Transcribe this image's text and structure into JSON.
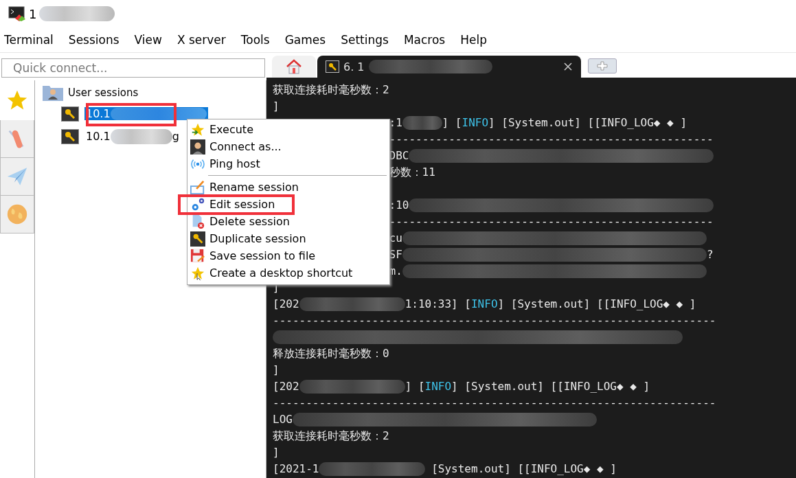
{
  "window": {
    "title": "1"
  },
  "menu_bar": [
    "Terminal",
    "Sessions",
    "View",
    "X server",
    "Tools",
    "Games",
    "Settings",
    "Macros",
    "Help"
  ],
  "quick_connect": {
    "placeholder": "Quick connect..."
  },
  "side_tabs": [
    {
      "selected": true
    },
    {
      "selected": false
    },
    {
      "selected": false
    },
    {
      "selected": false
    }
  ],
  "tree": {
    "label": "User sessions",
    "children": [
      {
        "label": "10.1",
        "selected": true,
        "annotated": true
      },
      {
        "label": "10.1",
        "suffix": "g",
        "selected": false,
        "annotated": false
      }
    ]
  },
  "tabs": [
    {
      "kind": "home",
      "selected": false
    },
    {
      "kind": "session",
      "label": "6. 1",
      "selected": true
    },
    {
      "kind": "new",
      "selected": false
    }
  ],
  "context_menu": [
    {
      "kind": "item",
      "label": "Execute",
      "annotated": false
    },
    {
      "kind": "item",
      "label": "Connect as...",
      "annotated": false
    },
    {
      "kind": "item",
      "label": "Ping host",
      "annotated": false
    },
    {
      "kind": "separator"
    },
    {
      "kind": "item",
      "label": "Rename session",
      "annotated": false
    },
    {
      "kind": "item",
      "label": "Edit session",
      "annotated": true
    },
    {
      "kind": "item",
      "label": "Delete session",
      "annotated": false
    },
    {
      "kind": "item",
      "label": "Duplicate session",
      "annotated": false
    },
    {
      "kind": "item",
      "label": "Save session to file",
      "annotated": false
    },
    {
      "kind": "item",
      "label": "Create a desktop shortcut",
      "annotated": false
    }
  ],
  "terminal_lines": [
    {
      "segments": [
        {
          "kind": "text",
          "text": "获取连接耗时毫秒数：2"
        }
      ]
    },
    {
      "segments": [
        {
          "kind": "text",
          "text": "]"
        }
      ]
    },
    {
      "segments": [
        {
          "kind": "hidden"
        },
        {
          "kind": "text",
          "text": ":1"
        },
        {
          "kind": "blur"
        },
        {
          "kind": "text",
          "text": "] ["
        },
        {
          "kind": "info",
          "text": "INFO"
        },
        {
          "kind": "text",
          "text": "] [System.out] [[INFO_LOG◆ ◆ ]"
        }
      ]
    },
    {
      "segments": [
        {
          "kind": "hidden"
        },
        {
          "kind": "text",
          "text": "-------------------------------------------------"
        }
      ]
    },
    {
      "segments": [
        {
          "kind": "hidden"
        },
        {
          "kind": "text",
          "text": "DBC"
        },
        {
          "kind": "blur"
        }
      ]
    },
    {
      "segments": [
        {
          "kind": "hidden"
        },
        {
          "kind": "text",
          "text": "秒数：11"
        }
      ]
    },
    {
      "blank_before": true,
      "segments": [
        {
          "kind": "hidden"
        },
        {
          "kind": "text",
          "text": ":10"
        },
        {
          "kind": "blur"
        }
      ]
    },
    {
      "segments": [
        {
          "kind": "hidden"
        },
        {
          "kind": "text",
          "text": "-------------------------------------------------"
        }
      ]
    },
    {
      "segments": [
        {
          "kind": "hidden"
        },
        {
          "kind": "text",
          "text": "cu"
        },
        {
          "kind": "blur"
        }
      ]
    },
    {
      "segments": [
        {
          "kind": "hidden"
        },
        {
          "kind": "text",
          "text": "SF"
        },
        {
          "kind": "blur"
        },
        {
          "kind": "text",
          "text": "?"
        }
      ]
    },
    {
      "segments": [
        {
          "kind": "hidden"
        },
        {
          "kind": "text",
          "text": "m."
        },
        {
          "kind": "blur"
        }
      ]
    },
    {
      "segments": [
        {
          "kind": "text",
          "text": "]"
        }
      ]
    },
    {
      "segments": [
        {
          "kind": "text",
          "text": "[202"
        },
        {
          "kind": "blur"
        },
        {
          "kind": "text",
          "text": "1:10:33] ["
        },
        {
          "kind": "info",
          "text": "INFO"
        },
        {
          "kind": "text",
          "text": "] [System.out] [[INFO_LOG◆ ◆ ]"
        }
      ]
    },
    {
      "segments": [
        {
          "kind": "text",
          "text": "-------------------------------------------------------------------"
        }
      ]
    },
    {
      "segments": [
        {
          "kind": "blur"
        }
      ]
    },
    {
      "segments": [
        {
          "kind": "text",
          "text": "释放连接耗时毫秒数：0"
        }
      ]
    },
    {
      "segments": [
        {
          "kind": "text",
          "text": "]"
        }
      ]
    },
    {
      "segments": [
        {
          "kind": "text",
          "text": "[202"
        },
        {
          "kind": "blur"
        },
        {
          "kind": "text",
          "text": "] ["
        },
        {
          "kind": "info",
          "text": "INFO"
        },
        {
          "kind": "text",
          "text": "] [System.out] [[INFO_LOG◆ ◆ ]"
        }
      ]
    },
    {
      "segments": [
        {
          "kind": "text",
          "text": "-------------------------------------------------------------------"
        }
      ]
    },
    {
      "segments": [
        {
          "kind": "text",
          "text": "LOG"
        },
        {
          "kind": "blur"
        }
      ]
    },
    {
      "segments": [
        {
          "kind": "text",
          "text": "获取连接耗时毫秒数：2"
        }
      ]
    },
    {
      "segments": [
        {
          "kind": "text",
          "text": "]"
        }
      ]
    },
    {
      "segments": [
        {
          "kind": "text",
          "text": "[2021-1"
        },
        {
          "kind": "blur"
        },
        {
          "kind": "text",
          "text": " [System.out] [[INFO_LOG◆ ◆ ]"
        }
      ]
    }
  ]
}
